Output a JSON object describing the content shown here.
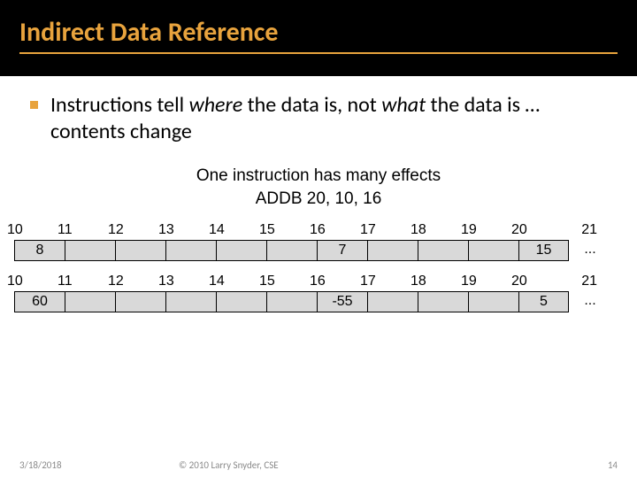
{
  "header": {
    "title": "Indirect Data Reference"
  },
  "bullet": {
    "pre": "Instructions tell ",
    "em1": "where",
    "mid": " the data is, not ",
    "em2": "what",
    "post": " the data is … contents change"
  },
  "caption": {
    "line1": "One instruction has many effects",
    "line2": "ADDB 20, 10, 16"
  },
  "tables": {
    "labelsA": [
      "10",
      "11",
      "12",
      "13",
      "14",
      "15",
      "16",
      "17",
      "18",
      "19",
      "20",
      "21"
    ],
    "rowA": [
      "8",
      "",
      "",
      "",
      "",
      "",
      "7",
      "",
      "",
      "",
      "15",
      "..."
    ],
    "labelsB": [
      "10",
      "11",
      "12",
      "13",
      "14",
      "15",
      "16",
      "17",
      "18",
      "19",
      "20",
      "21"
    ],
    "rowB": [
      "60",
      "",
      "",
      "",
      "",
      "",
      "-55",
      "",
      "",
      "",
      "5",
      "..."
    ]
  },
  "footer": {
    "date": "3/18/2018",
    "copyright": "© 2010 Larry Snyder, CSE",
    "page": "14"
  }
}
